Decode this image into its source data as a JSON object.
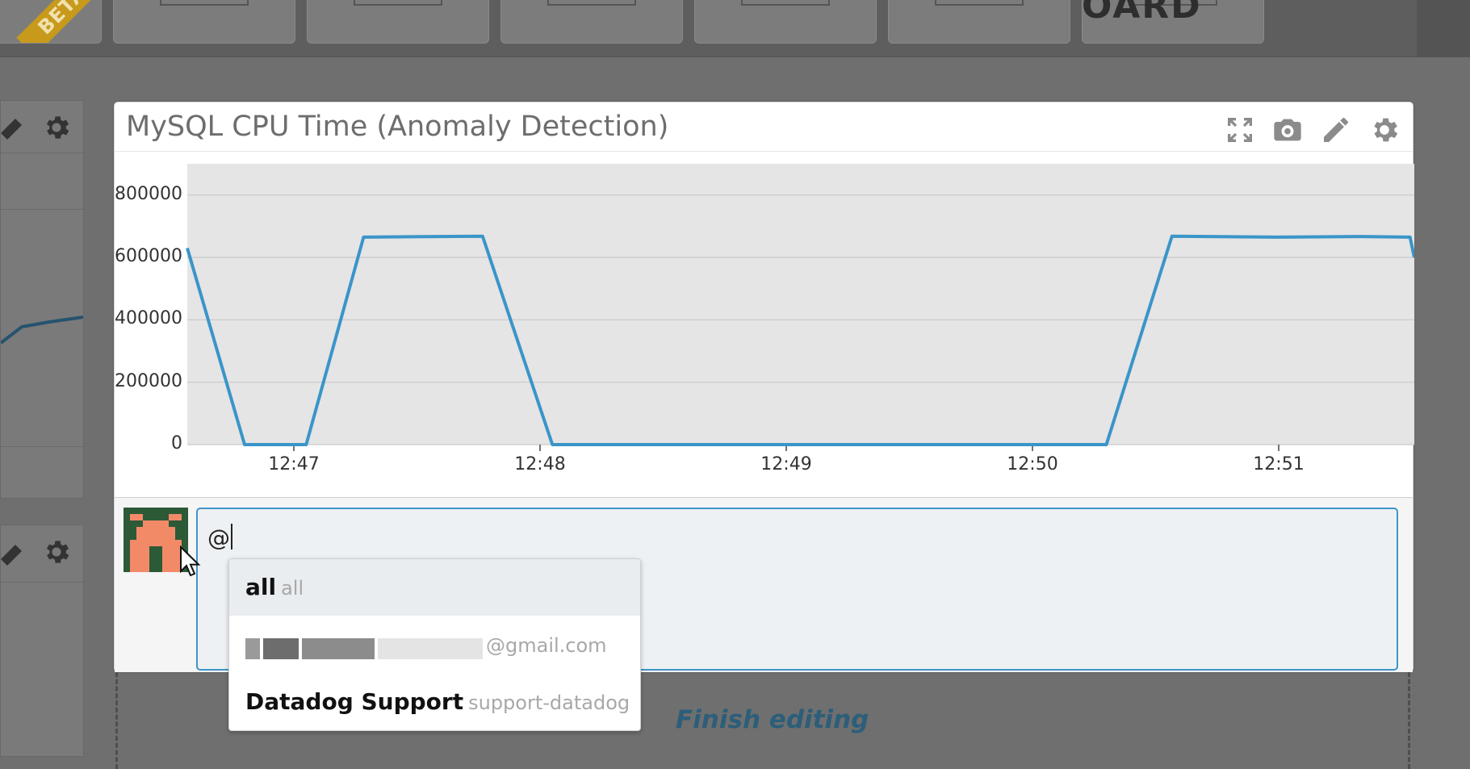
{
  "topbar": {
    "beta_label": "BETA",
    "logo_fragment": "OARD"
  },
  "widget": {
    "title": "MySQL CPU Time (Anomaly Detection)",
    "icons": [
      "fullscreen-icon",
      "camera-icon",
      "pencil-icon",
      "gear-icon"
    ]
  },
  "chart_data": {
    "type": "line",
    "title": "MySQL CPU Time (Anomaly Detection)",
    "xlabel": "",
    "ylabel": "",
    "ylim": [
      0,
      900000
    ],
    "yticks": [
      "800000",
      "600000",
      "400000",
      "200000",
      "0"
    ],
    "xticks": [
      "12:47",
      "12:48",
      "12:49",
      "12:50",
      "12:51"
    ],
    "grid": true,
    "series": [
      {
        "color": "#3a95c8",
        "x": [
          "12:46:34",
          "12:46:48",
          "12:47:03",
          "12:47:17",
          "12:47:46",
          "12:48:03",
          "12:50:18",
          "12:50:34",
          "12:51:00",
          "12:51:20",
          "12:51:32",
          "12:51:35"
        ],
        "values": [
          630000,
          0,
          0,
          665000,
          668000,
          0,
          0,
          668000,
          665000,
          667000,
          665000,
          600000
        ]
      }
    ]
  },
  "comment": {
    "input_value": "@"
  },
  "mention_dropdown": {
    "items": [
      {
        "name": "all",
        "handle": "all"
      },
      {
        "name": "",
        "handle": "@gmail.com"
      },
      {
        "name": "Datadog Support",
        "handle": "support-datadog"
      }
    ]
  },
  "edit": {
    "finish_label": "Finish editing"
  }
}
